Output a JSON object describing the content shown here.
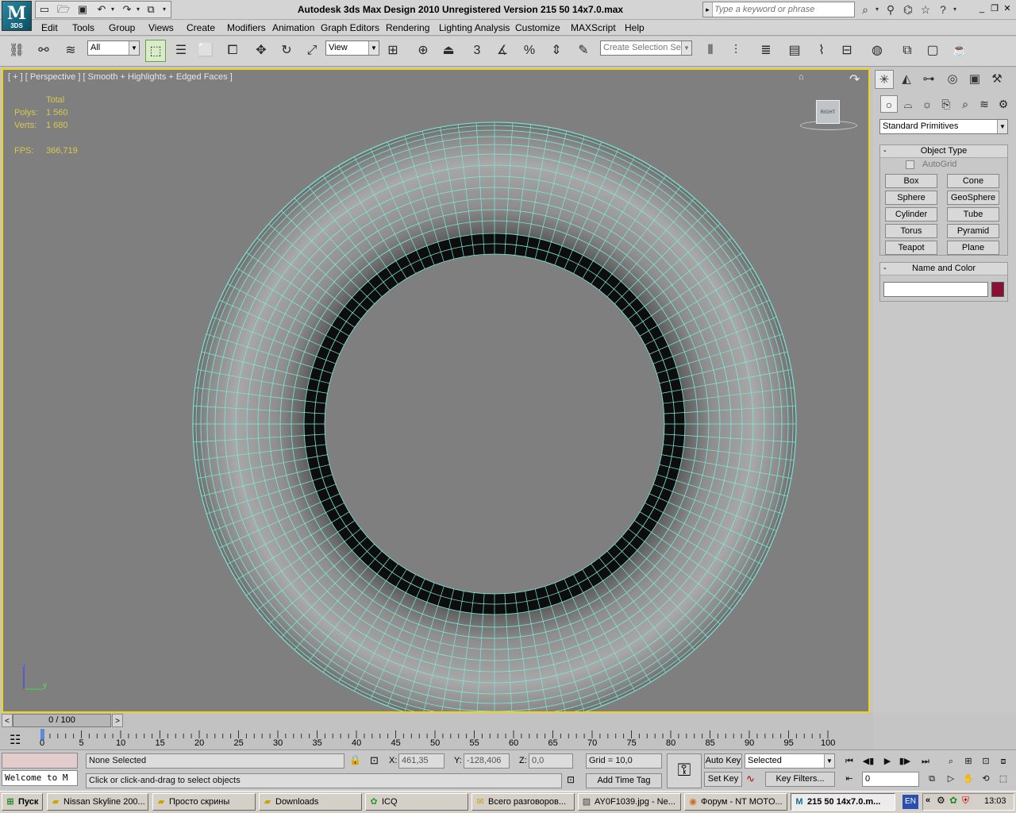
{
  "app": {
    "logo_text": "M",
    "logo_sub": "3DS",
    "window_title": "Autodesk 3ds Max Design 2010   Unregistered Version     215 50 14x7.0.max",
    "search_placeholder": "Type a keyword or phrase"
  },
  "menu": [
    "Edit",
    "Tools",
    "Group",
    "Views",
    "Create",
    "Modifiers",
    "Animation",
    "Graph Editors",
    "Rendering",
    "Lighting Analysis",
    "Customize",
    "MAXScript",
    "Help"
  ],
  "toolbar": {
    "filter_value": "All",
    "refcoord_value": "View",
    "selection_set_placeholder": "Create Selection Se",
    "snap_label": "3",
    "select_button_active": true
  },
  "viewport": {
    "label": "[ + ] [ Perspective ] [ Smooth + Highlights + Edged Faces ]",
    "stats_header": "Total",
    "polys_label": "Polys:",
    "polys_value": "1 560",
    "verts_label": "Verts:",
    "verts_value": "1 680",
    "fps_label": "FPS:",
    "fps_value": "366,719",
    "viewcube_label": "RIGHT",
    "axis_z": "z",
    "axis_y": "y",
    "border_color": "#f2d21a",
    "wire_color": "#7fe8d8"
  },
  "command_panel": {
    "category": "Standard Primitives",
    "object_type_title": "Object Type",
    "autogrid_label": "AutoGrid",
    "primitives": [
      "Box",
      "Cone",
      "Sphere",
      "GeoSphere",
      "Cylinder",
      "Tube",
      "Torus",
      "Pyramid",
      "Teapot",
      "Plane"
    ],
    "name_color_title": "Name and Color",
    "swatch_color": "#8b1035"
  },
  "timeline": {
    "slider_label": "0 / 100",
    "ticks": [
      "0",
      "5",
      "10",
      "15",
      "20",
      "25",
      "30",
      "35",
      "40",
      "45",
      "50",
      "55",
      "60",
      "65",
      "70",
      "75",
      "80",
      "85",
      "90",
      "95",
      "100"
    ]
  },
  "status": {
    "maxscript_listener": "Welcome to M",
    "selection_info": "None Selected",
    "prompt": "Click or click-and-drag to select objects",
    "x_label": "X:",
    "x_value": "461,35",
    "y_label": "Y:",
    "y_value": "-128,406",
    "z_label": "Z:",
    "z_value": "0,0",
    "grid": "Grid = 10,0",
    "add_time_tag": "Add Time Tag",
    "auto_key": "Auto Key",
    "set_key": "Set Key",
    "key_mode": "Selected",
    "key_filters": "Key Filters...",
    "frame_value": "0"
  },
  "taskbar": {
    "start": "Пуск",
    "tasks": [
      {
        "label": "Nissan Skyline 200...",
        "icon": "folder-icon"
      },
      {
        "label": "Просто скрины",
        "icon": "folder-icon"
      },
      {
        "label": "Downloads",
        "icon": "folder-icon"
      },
      {
        "label": "ICQ",
        "icon": "icq-icon"
      },
      {
        "label": "Всего разговоров...",
        "icon": "chat-icon"
      },
      {
        "label": "AY0F1039.jpg - Ne...",
        "icon": "image-icon"
      },
      {
        "label": "Форум - NT MOTO...",
        "icon": "firefox-icon"
      },
      {
        "label": "215 50 14x7.0.m...",
        "icon": "max-icon"
      }
    ],
    "lang": "EN",
    "clock": "13:03"
  }
}
